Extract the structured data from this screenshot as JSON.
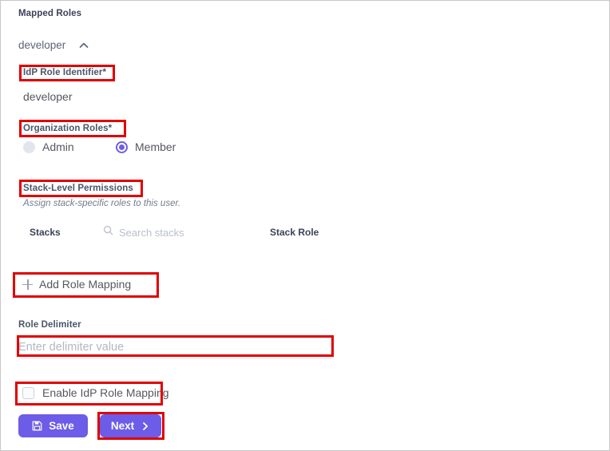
{
  "section": {
    "title": "Mapped Roles"
  },
  "accordion": {
    "label": "developer",
    "chevron_icon": "chevron-up-icon",
    "expanded": true
  },
  "idp_role_identifier": {
    "label": "IdP Role Identifier*",
    "value": "developer"
  },
  "organization_roles": {
    "label": "Organization Roles*",
    "options": [
      {
        "label": "Admin",
        "selected": false
      },
      {
        "label": "Member",
        "selected": true
      }
    ]
  },
  "stack_level_permissions": {
    "label": "Stack-Level Permissions",
    "description": "Assign stack-specific roles to this user.",
    "columns": {
      "stacks": "Stacks",
      "stack_role": "Stack Role"
    },
    "search": {
      "icon": "search-icon",
      "placeholder": "Search stacks",
      "value": ""
    },
    "rows": []
  },
  "add_role_mapping": {
    "label": "Add Role Mapping",
    "icon": "plus-icon"
  },
  "role_delimiter": {
    "label": "Role Delimiter",
    "placeholder": "Enter delimiter value",
    "value": ""
  },
  "enable_idp_role_mapping": {
    "label": "Enable IdP Role Mapping",
    "checked": false
  },
  "actions": {
    "save": {
      "label": "Save",
      "icon": "save-floppy-icon"
    },
    "next": {
      "label": "Next",
      "icon": "chevron-right-icon"
    }
  },
  "colors": {
    "accent_purple": "#6c5ce7",
    "annotation_red": "#e00000",
    "label_text": "#4a5568",
    "value_text": "#55585f",
    "placeholder_text": "#b2b7c2"
  },
  "annotations": [
    {
      "target": "idp-role-identifier-label"
    },
    {
      "target": "organization-roles-label"
    },
    {
      "target": "stack-level-permissions-label"
    },
    {
      "target": "add-role-mapping-button"
    },
    {
      "target": "delimiter-input"
    },
    {
      "target": "enable-idp-role-mapping-checkbox-row"
    },
    {
      "target": "next-button"
    }
  ]
}
